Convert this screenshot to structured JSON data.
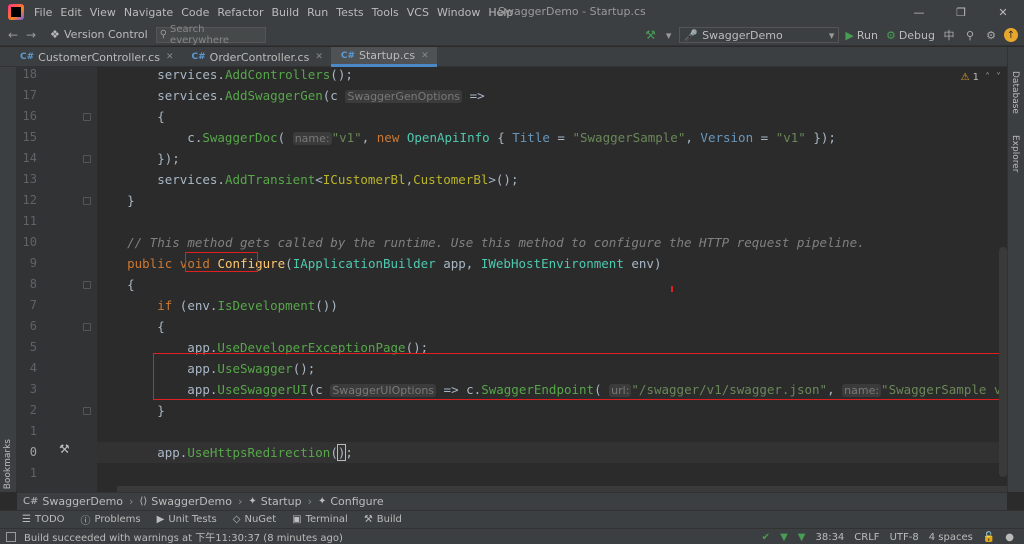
{
  "menu": [
    "File",
    "Edit",
    "View",
    "Navigate",
    "Code",
    "Refactor",
    "Build",
    "Run",
    "Tests",
    "Tools",
    "VCS",
    "Window",
    "Help"
  ],
  "window_title": "SwaggerDemo - Startup.cs",
  "toolbar": {
    "version_control": "Version Control",
    "search_placeholder": "Search everywhere",
    "run_config": "SwaggerDemo",
    "run_label": "Run",
    "debug_label": "Debug"
  },
  "tabs": [
    {
      "lang": "C#",
      "label": "CustomerController.cs"
    },
    {
      "lang": "C#",
      "label": "OrderController.cs"
    },
    {
      "lang": "C#",
      "label": "Startup.cs"
    }
  ],
  "side_panels": {
    "right": [
      "Database",
      "Explorer"
    ],
    "left": "Bookmarks"
  },
  "editor": {
    "warning_count": "1",
    "line_numbers": [
      "18",
      "17",
      "16",
      "15",
      "14",
      "13",
      "12",
      "11",
      "10",
      "9",
      "8",
      "7",
      "6",
      "5",
      "4",
      "3",
      "2",
      "1",
      "0",
      "1",
      ""
    ],
    "hints": {
      "swagger_gen_options": "SwaggerGenOptions",
      "name": "name:",
      "swagger_ui_options": "SwaggerUIOptions",
      "url": "url:",
      "name2": "name:"
    },
    "comment": "// This method gets called by the runtime. Use this method to configure the HTTP request pipeline."
  },
  "breadcrumb": [
    "SwaggerDemo",
    "SwaggerDemo",
    "Startup",
    "Configure"
  ],
  "tool_windows": [
    "TODO",
    "Problems",
    "Unit Tests",
    "NuGet",
    "Terminal",
    "Build"
  ],
  "status": {
    "message": "Build succeeded with warnings at 下午11:30:37 (8 minutes ago)",
    "position": "38:34",
    "line_ending": "CRLF",
    "encoding": "UTF-8",
    "indent": "4 spaces"
  }
}
